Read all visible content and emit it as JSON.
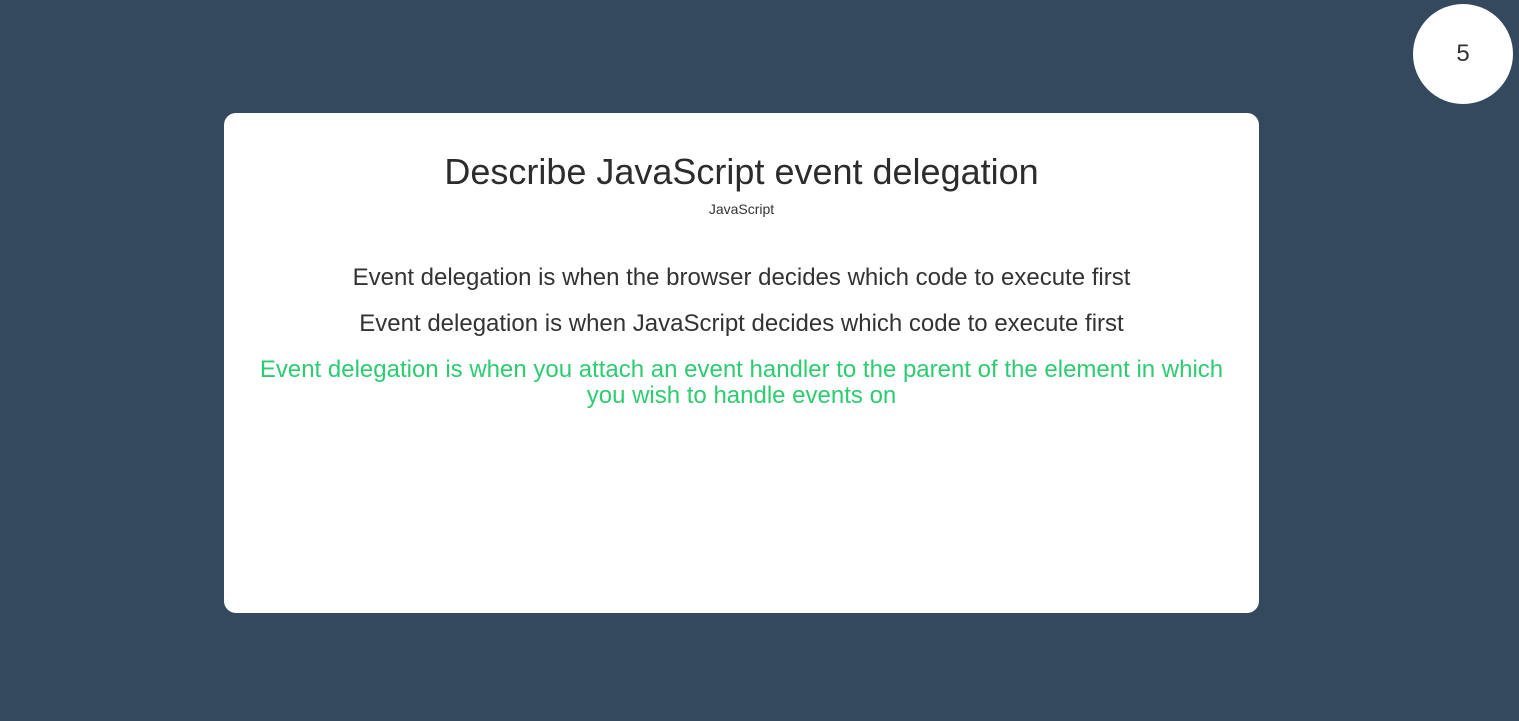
{
  "score": {
    "value": "5"
  },
  "question": {
    "title": "Describe JavaScript event delegation",
    "category": "JavaScript"
  },
  "answers": [
    {
      "text": "Event delegation is when the browser decides which code to execute first",
      "state": "default"
    },
    {
      "text": "Event delegation is when JavaScript decides which code to execute first",
      "state": "default"
    },
    {
      "text": "Event delegation is when you attach an event handler to the parent of the element in which you wish to handle events on",
      "state": "correct"
    }
  ],
  "colors": {
    "background": "#35495e",
    "card": "#ffffff",
    "text": "#333333",
    "correct": "#2ecc71"
  }
}
